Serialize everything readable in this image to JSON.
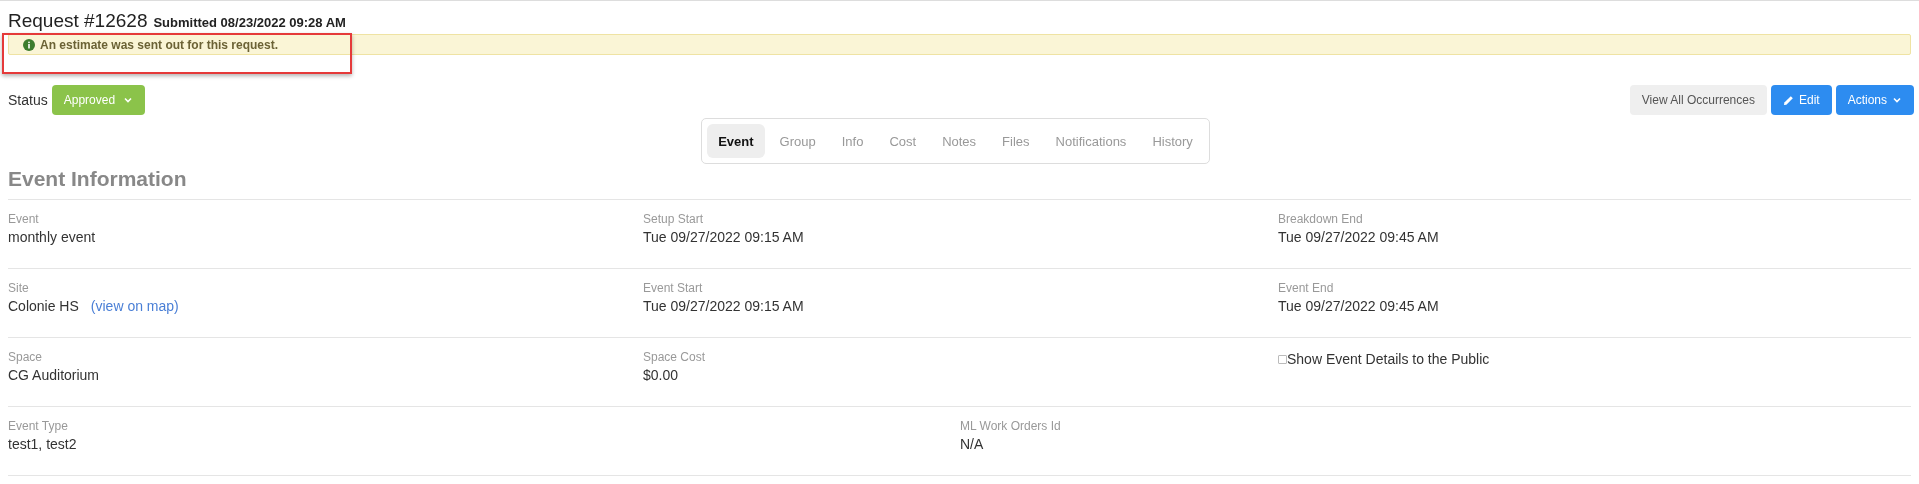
{
  "header": {
    "title": "Request #12628",
    "submitted": "Submitted 08/23/2022 09:28 AM"
  },
  "alert": {
    "message": "An estimate was sent out for this request.",
    "highlighted": true
  },
  "status": {
    "label": "Status",
    "value": "Approved"
  },
  "buttons": [
    {
      "label": "View All Occurrences",
      "kind": "plain"
    },
    {
      "label": "Edit",
      "kind": "edit"
    },
    {
      "label": "Actions",
      "kind": "dropdown"
    }
  ],
  "tabs": [
    {
      "label": "Event",
      "selected": true
    },
    {
      "label": "Group",
      "selected": false
    },
    {
      "label": "Info",
      "selected": false
    },
    {
      "label": "Cost",
      "selected": false
    },
    {
      "label": "Notes",
      "selected": false
    },
    {
      "label": "Files",
      "selected": false
    },
    {
      "label": "Notifications",
      "selected": false
    },
    {
      "label": "History",
      "selected": false
    }
  ],
  "section_title": "Event Information",
  "rows": [
    {
      "fields": [
        {
          "kind": "text",
          "label": "Event",
          "value": "monthly event"
        },
        {
          "kind": "text",
          "label": "Setup Start",
          "value": "Tue 09/27/2022 09:15 AM"
        },
        {
          "kind": "text",
          "label": "Breakdown End",
          "value": "Tue 09/27/2022 09:45 AM"
        }
      ]
    },
    {
      "fields": [
        {
          "kind": "link",
          "label": "Site",
          "value": "Colonie HS",
          "link": "(view on map)"
        },
        {
          "kind": "text",
          "label": "Event Start",
          "value": "Tue 09/27/2022 09:15 AM"
        },
        {
          "kind": "text",
          "label": "Event End",
          "value": "Tue 09/27/2022 09:45 AM"
        }
      ]
    },
    {
      "fields": [
        {
          "kind": "text",
          "label": "Space",
          "value": "CG Auditorium"
        },
        {
          "kind": "text",
          "label": "Space Cost",
          "value": "$0.00"
        },
        {
          "kind": "checkbox",
          "label": "Show Event Details to the Public",
          "checked": false
        }
      ]
    },
    {
      "fields": [
        {
          "kind": "text",
          "label": "Event Type",
          "value": "test1, test2"
        },
        {
          "kind": "text",
          "label": "ML Work Orders Id",
          "value": "N/A"
        }
      ]
    }
  ]
}
